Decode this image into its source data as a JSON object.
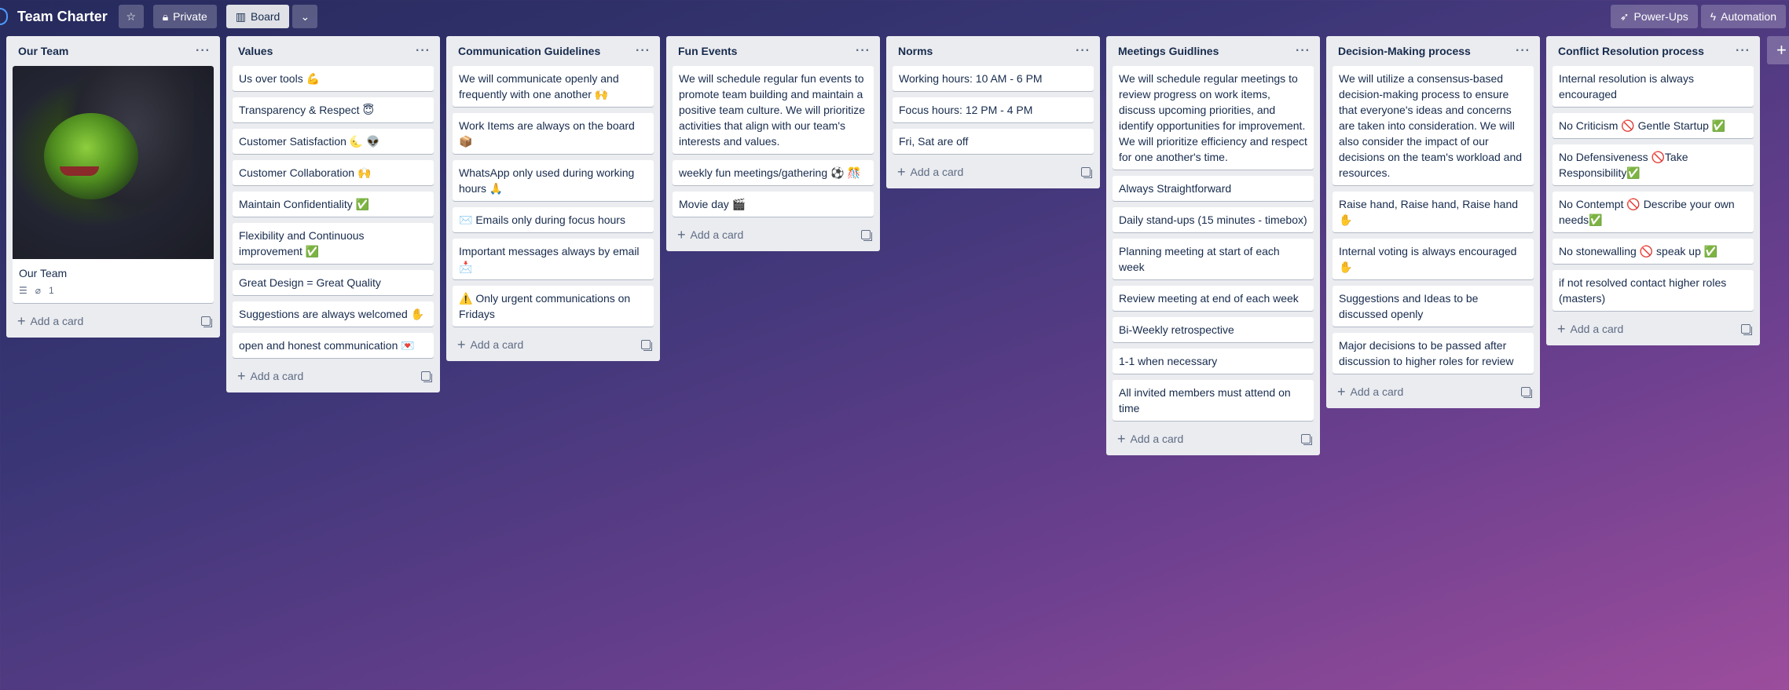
{
  "header": {
    "title": "Team Charter",
    "visibility_label": "Private",
    "view_label": "Board",
    "powerups_label": "Power-Ups",
    "automation_label": "Automation"
  },
  "colors": {
    "accent": "#0079bf",
    "list_bg": "#ebecf0"
  },
  "lists": [
    {
      "title": "Our Team",
      "cards": [],
      "cover_card": {
        "title": "Our Team",
        "attachments": "1"
      },
      "add_label": "Add a card"
    },
    {
      "title": "Values",
      "cards": [
        "Us over tools 💪",
        "Transparency & Respect 😇",
        "Customer Satisfaction 🌜 👽",
        "Customer Collaboration 🙌",
        "Maintain Confidentiality ✅",
        "Flexibility and Continuous improvement ✅",
        "Great Design = Great Quality",
        "Suggestions are always welcomed ✋",
        "open and honest communication 💌"
      ],
      "add_label": "Add a card"
    },
    {
      "title": "Communication Guidelines",
      "cards": [
        "We will communicate openly and frequently with one another 🙌",
        "Work Items are always on the board 📦",
        "WhatsApp only used during working hours 🙏",
        "✉️ Emails only during focus hours",
        "Important messages always by email 📩",
        "⚠️ Only urgent communications on Fridays"
      ],
      "add_label": "Add a card"
    },
    {
      "title": "Fun Events",
      "cards": [
        "We will schedule regular fun events to promote team building and maintain a positive team culture. We will prioritize activities that align with our team's interests and values.",
        "weekly fun meetings/gathering ⚽ 🎊",
        "Movie day 🎬"
      ],
      "add_label": "Add a card"
    },
    {
      "title": "Norms",
      "cards": [
        "Working hours: 10 AM - 6 PM",
        "Focus hours: 12 PM - 4 PM",
        "Fri, Sat are off"
      ],
      "add_label": "Add a card"
    },
    {
      "title": "Meetings Guidlines",
      "cards": [
        "We will schedule regular meetings to review progress on work items, discuss upcoming priorities, and identify opportunities for improvement. We will prioritize efficiency and respect for one another's time.",
        "Always Straightforward",
        "Daily stand-ups (15 minutes - timebox)",
        "Planning meeting at start of each week",
        "Review meeting at end of each week",
        "Bi-Weekly retrospective",
        "1-1 when necessary",
        "All invited members must attend on time"
      ],
      "add_label": "Add a card"
    },
    {
      "title": "Decision-Making process",
      "cards": [
        "We will utilize a consensus-based decision-making process to ensure that everyone's ideas and concerns are taken into consideration. We will also consider the impact of our decisions on the team's workload and resources.",
        "Raise hand, Raise hand, Raise hand ✋",
        "Internal voting is always encouraged ✋",
        "Suggestions and Ideas to be discussed openly",
        "Major decisions to be passed after discussion to higher roles for review"
      ],
      "add_label": "Add a card"
    },
    {
      "title": "Conflict Resolution process",
      "cards": [
        "Internal resolution is always encouraged",
        "No Criticism 🚫 Gentle Startup ✅",
        "No Defensiveness 🚫Take Responsibility✅",
        "No Contempt 🚫 Describe your own needs✅",
        "No stonewalling 🚫 speak up ✅",
        "if not resolved contact higher roles (masters)"
      ],
      "add_label": "Add a card"
    }
  ]
}
